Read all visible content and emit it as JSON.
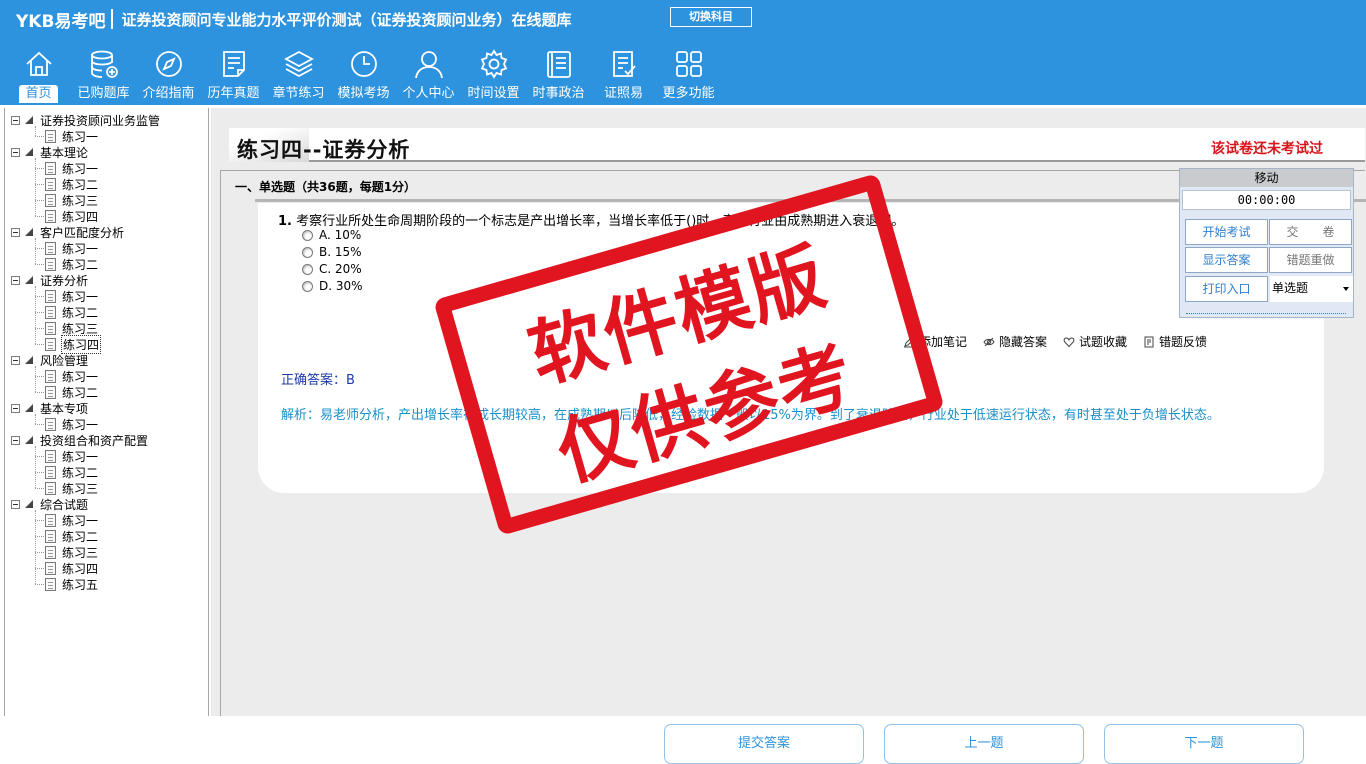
{
  "header": {
    "logo": "YKB易考吧",
    "title": "证券投资顾问专业能力水平评价测试（证券投资顾问业务）在线题库",
    "switch_subject": "切换科目",
    "bg_color": "#2e93de"
  },
  "nav": [
    {
      "label": "首页",
      "icon": "home-icon"
    },
    {
      "label": "已购题库",
      "icon": "database-icon"
    },
    {
      "label": "介绍指南",
      "icon": "compass-icon"
    },
    {
      "label": "历年真题",
      "icon": "document-list-icon"
    },
    {
      "label": "章节练习",
      "icon": "layers-icon"
    },
    {
      "label": "模拟考场",
      "icon": "clock-icon"
    },
    {
      "label": "个人中心",
      "icon": "user-icon"
    },
    {
      "label": "时间设置",
      "icon": "gear-icon"
    },
    {
      "label": "时事政治",
      "icon": "news-icon"
    },
    {
      "label": "证照易",
      "icon": "checklist-icon"
    },
    {
      "label": "更多功能",
      "icon": "grid-icon"
    }
  ],
  "tree": [
    {
      "label": "证券投资顾问业务监管",
      "children": [
        "练习一"
      ]
    },
    {
      "label": "基本理论",
      "children": [
        "练习一",
        "练习二",
        "练习三",
        "练习四"
      ]
    },
    {
      "label": "客户匹配度分析",
      "children": [
        "练习一",
        "练习二"
      ]
    },
    {
      "label": "证券分析",
      "children": [
        "练习一",
        "练习二",
        "练习三",
        "练习四"
      ]
    },
    {
      "label": "风险管理",
      "children": [
        "练习一",
        "练习二"
      ]
    },
    {
      "label": "基本专项",
      "children": [
        "练习一"
      ]
    },
    {
      "label": "投资组合和资产配置",
      "children": [
        "练习一",
        "练习二",
        "练习三"
      ]
    },
    {
      "label": "综合试题",
      "children": [
        "练习一",
        "练习二",
        "练习三",
        "练习四",
        "练习五"
      ]
    }
  ],
  "paper": {
    "title": "练习四--证券分析",
    "status": "该试卷还未考试过",
    "section": "一、单选题（共36题，每题1分）"
  },
  "question": {
    "number": "1.",
    "text": "考察行业所处生命周期阶段的一个标志是产出增长率，当增长率低于()时，表明行业由成熟期进入衰退期。",
    "options": [
      "A. 10%",
      "B. 15%",
      "C. 20%",
      "D. 30%"
    ],
    "tools": [
      "添加笔记",
      "隐藏答案",
      "试题收藏",
      "错题反馈"
    ],
    "answer": "正确答案：B",
    "analysis": "解析：易老师分析，产出增长率在成长期较高，在成熟期以后降低，经验数据一般以15%为界。到了衰退阶段，行业处于低速运行状态，有时甚至处于负增长状态。"
  },
  "control": {
    "move": "移动",
    "timer": "00:00:00",
    "start": "开始考试",
    "submit": "交　　卷",
    "show_answer": "显示答案",
    "redo_wrong": "错题重做",
    "print": "打印入口",
    "type_select": "单选题"
  },
  "footer": {
    "submit_answer": "提交答案",
    "prev": "上一题",
    "next": "下一题"
  },
  "stamp": {
    "line1": "软件模版",
    "line2": "仅供参考",
    "color": "#e11520"
  }
}
